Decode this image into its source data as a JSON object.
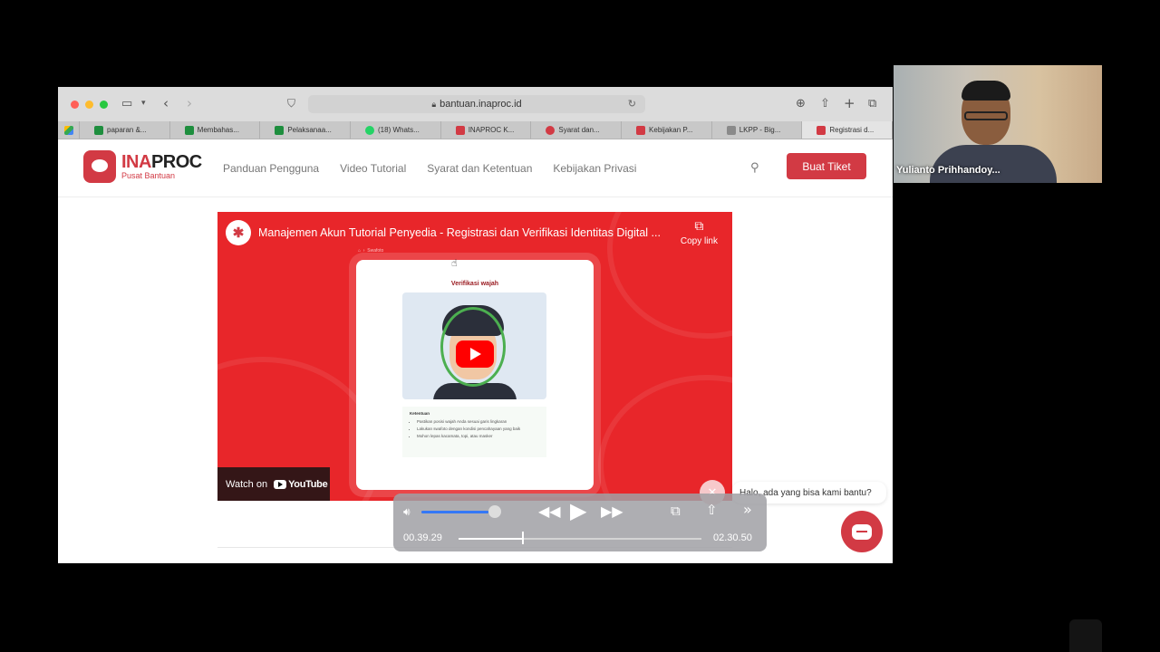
{
  "browser": {
    "url": "bantuan.inaproc.id",
    "tabs": [
      {
        "label": "paparan &...",
        "color": "#1e8e3e"
      },
      {
        "label": "Membahas...",
        "color": "#1e8e3e"
      },
      {
        "label": "Pelaksanaa...",
        "color": "#1e8e3e"
      },
      {
        "label": "(18) Whats...",
        "color": "#25d366"
      },
      {
        "label": "INAPROC K...",
        "color": "#d23a44"
      },
      {
        "label": "Syarat dan...",
        "color": "#d23a44"
      },
      {
        "label": "Kebijakan P...",
        "color": "#d23a44"
      },
      {
        "label": "LKPP - Big...",
        "color": "#8a8a8a"
      },
      {
        "label": "Registrasi d...",
        "color": "#d23a44"
      }
    ]
  },
  "site": {
    "logo_ina": "INA",
    "logo_proc": "PROC",
    "logo_sub": "Pusat Bantuan",
    "nav": [
      "Panduan Pengguna",
      "Video Tutorial",
      "Syarat dan Ketentuan",
      "Kebijakan Privasi"
    ],
    "cta": "Buat Tiket",
    "brand_color": "#d23a44"
  },
  "video": {
    "title": "Manajemen Akun Tutorial Penyedia - Registrasi dan Verifikasi Identitas Digital ...",
    "copy_link": "Copy link",
    "watch_on": "Watch on",
    "youtube": "YouTube",
    "breadcrumb": "Swafoto",
    "card_title": "Verifikasi wajah",
    "rules_heading": "Ketentuan",
    "rules": [
      "Pastikan posisi wajah Anda sesuai garis lingkaran",
      "Lakukan swafoto dengan kondisi pencahayaan yang baik",
      "Mohon lepas kacamata, topi, atau masker"
    ]
  },
  "chat": {
    "greeting": "Halo, ada yang bisa kami bantu?"
  },
  "player": {
    "current_time": "00.39.29",
    "total_time": "02.30.50",
    "progress": 0.26,
    "volume": 0.9
  },
  "webcam": {
    "name": "Yulianto Prihhandoy..."
  }
}
